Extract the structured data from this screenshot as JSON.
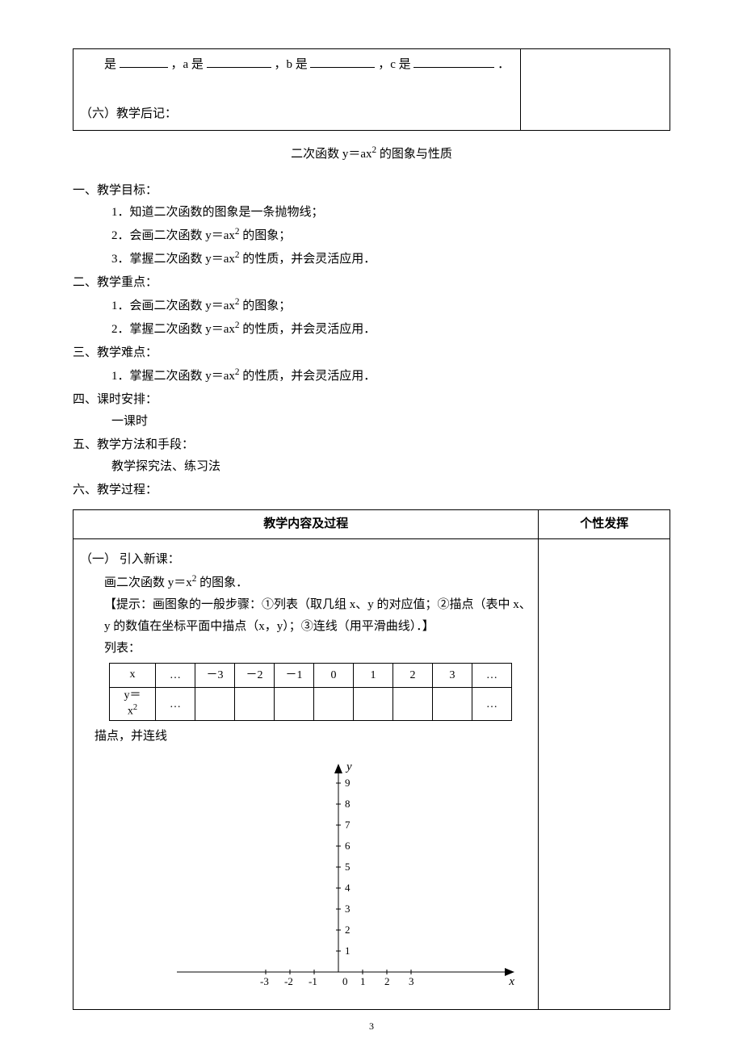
{
  "topBox": {
    "line_prefix": "是",
    "seg_a": "，a 是",
    "seg_b": "，b 是",
    "seg_c": "，c 是",
    "tail": "．",
    "afterline": "（六）教学后记："
  },
  "lessonTitle": "二次函数 y＝ax",
  "lessonTitleSup": "2",
  "lessonTitleTail": " 的图象与性质",
  "sec1": {
    "head": "一、教学目标：",
    "i1": "1．知道二次函数的图象是一条抛物线；",
    "i2a": "2．会画二次函数 y＝ax",
    "i2b": " 的图象；",
    "i3a": "3．掌握二次函数 y＝ax",
    "i3b": " 的性质，并会灵活应用．"
  },
  "sec2": {
    "head": "二、教学重点：",
    "i1a": "1．会画二次函数 y＝ax",
    "i1b": " 的图象；",
    "i2a": "2．掌握二次函数 y＝ax",
    "i2b": " 的性质，并会灵活应用．"
  },
  "sec3": {
    "head": "三、教学难点：",
    "i1a": "1．掌握二次函数 y＝ax",
    "i1b": " 的性质，并会灵活应用．"
  },
  "sec4": {
    "head": "四、课时安排：",
    "i1": "一课时"
  },
  "sec5": {
    "head": "五、教学方法和手段：",
    "i1": "教学探究法、练习法"
  },
  "sec6": {
    "head": "六、教学过程："
  },
  "contentHdrLeft": "教学内容及过程",
  "contentHdrRight": "个性发挥",
  "body": {
    "h1": "（一） 引入新课：",
    "p1a": "画二次函数 y＝x",
    "p1b": " 的图象．",
    "p2": "【提示：画图象的一般步骤：①列表（取几组 x、y 的对应值；②描点（表中 x、y 的数值在坐标平面中描点（x，y）；③连线（用平滑曲线）．】",
    "p3": "列表：",
    "p4": "描点，并连线"
  },
  "dataTable": {
    "row1": [
      "x",
      "…",
      "－3",
      "－2",
      "－1",
      "0",
      "1",
      "2",
      "3",
      "…"
    ],
    "row2label_a": "y＝",
    "row2label_b": "x",
    "row2": [
      "",
      "…",
      "",
      "",
      "",
      "",
      "",
      "",
      "",
      "…"
    ]
  },
  "chart_data": {
    "type": "scatter",
    "title": "",
    "xlabel": "x",
    "ylabel": "y",
    "xlim": [
      -4,
      4
    ],
    "ylim": [
      0,
      9
    ],
    "xticks": [
      -3,
      -2,
      -1,
      0,
      1,
      2,
      3
    ],
    "yticks": [
      1,
      2,
      3,
      4,
      5,
      6,
      7,
      8,
      9
    ],
    "series": []
  },
  "pageNumber": "3"
}
